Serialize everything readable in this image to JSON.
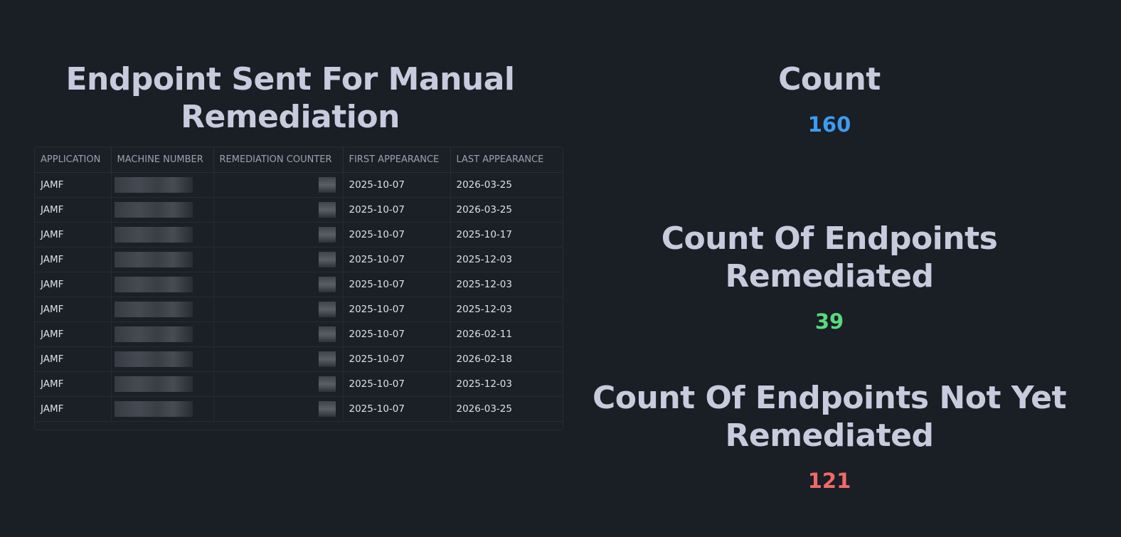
{
  "table_panel": {
    "title": "Endpoint Sent For Manual Remediation",
    "columns": [
      "APPLICATION",
      "MACHINE NUMBER",
      "REMEDIATION COUNTER",
      "FIRST APPEARANCE",
      "LAST APPEARANCE"
    ],
    "rows": [
      {
        "application": "JAMF",
        "first": "2025-10-07",
        "last": "2026-03-25"
      },
      {
        "application": "JAMF",
        "first": "2025-10-07",
        "last": "2026-03-25"
      },
      {
        "application": "JAMF",
        "first": "2025-10-07",
        "last": "2025-10-17"
      },
      {
        "application": "JAMF",
        "first": "2025-10-07",
        "last": "2025-12-03"
      },
      {
        "application": "JAMF",
        "first": "2025-10-07",
        "last": "2025-12-03"
      },
      {
        "application": "JAMF",
        "first": "2025-10-07",
        "last": "2025-12-03"
      },
      {
        "application": "JAMF",
        "first": "2025-10-07",
        "last": "2026-02-11"
      },
      {
        "application": "JAMF",
        "first": "2025-10-07",
        "last": "2026-02-18"
      },
      {
        "application": "JAMF",
        "first": "2025-10-07",
        "last": "2025-12-03"
      },
      {
        "application": "JAMF",
        "first": "2025-10-07",
        "last": "2026-03-25"
      }
    ]
  },
  "stats": {
    "count": {
      "title": "Count",
      "value": "160",
      "color": "#3d9cf0"
    },
    "remediated": {
      "title": "Count Of Endpoints Remediated",
      "value": "39",
      "color": "#5ad97c"
    },
    "not_remediated": {
      "title": "Count Of Endpoints Not Yet Remediated",
      "value": "121",
      "color": "#f06a67"
    }
  },
  "colors": {
    "background": "#1a1e25",
    "title_text": "#c6cbdd"
  }
}
